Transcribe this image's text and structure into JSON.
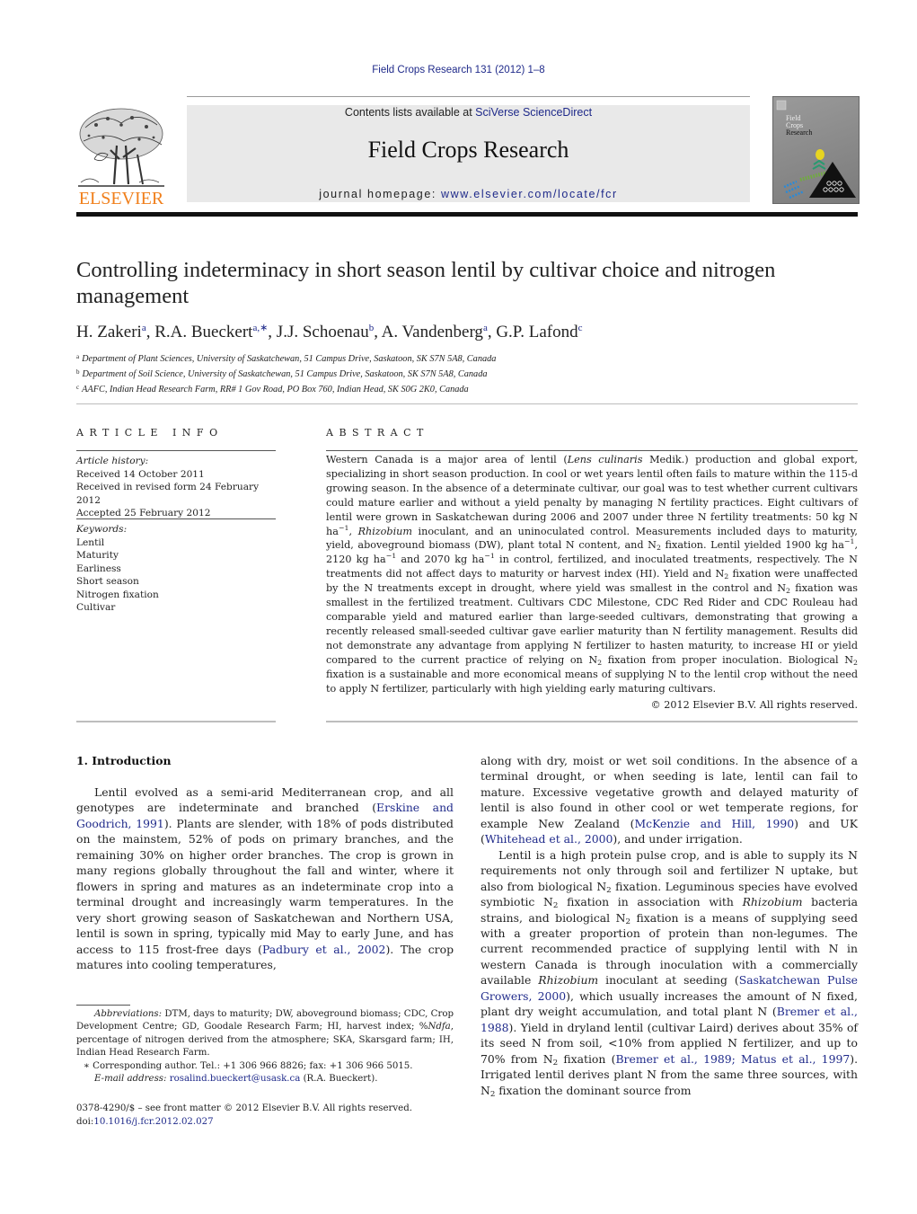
{
  "header": {
    "journal_ref": "Field Crops Research 131 (2012) 1–8",
    "contents_prefix": "Contents lists available at ",
    "contents_link": "SciVerse ScienceDirect",
    "journal_title": "Field Crops Research",
    "homepage_prefix": "journal homepage: ",
    "homepage_link": "www.elsevier.com/locate/fcr",
    "publisher_logo_text": "ELSEVIER",
    "cover_title": [
      "Field",
      "Crops",
      "Research"
    ],
    "colors": {
      "publisher_orange": "#f07f1b",
      "link_blue": "#1f2a8a",
      "banner_gray": "#e9e9e9"
    }
  },
  "article": {
    "title": "Controlling indeterminacy in short season lentil by cultivar choice and nitrogen management",
    "authors": [
      {
        "name": "H. Zakeri",
        "sup": "a"
      },
      {
        "name": "R.A. Bueckert",
        "sup": "a,∗"
      },
      {
        "name": "J.J. Schoenau",
        "sup": "b"
      },
      {
        "name": "A. Vandenberg",
        "sup": "a"
      },
      {
        "name": "G.P. Lafond",
        "sup": "c"
      }
    ],
    "affiliations": [
      {
        "key": "a",
        "text": "Department of Plant Sciences, University of Saskatchewan, 51 Campus Drive, Saskatoon, SK S7N 5A8, Canada"
      },
      {
        "key": "b",
        "text": "Department of Soil Science, University of Saskatchewan, 51 Campus Drive, Saskatoon, SK S7N 5A8, Canada"
      },
      {
        "key": "c",
        "text": "AAFC, Indian Head Research Farm, RR# 1 Gov Road, PO Box 760, Indian Head, SK S0G 2K0, Canada"
      }
    ]
  },
  "article_info": {
    "heading": "ARTICLE INFO",
    "history_label": "Article history:",
    "history": [
      "Received 14 October 2011",
      "Received in revised form 24 February 2012",
      "Accepted 25 February 2012"
    ],
    "keywords_label": "Keywords:",
    "keywords": [
      "Lentil",
      "Maturity",
      "Earliness",
      "Short season",
      "Nitrogen fixation",
      "Cultivar"
    ]
  },
  "abstract": {
    "heading": "ABSTRACT",
    "segments": [
      "Western Canada is a major area of lentil (",
      "Lens culinaris",
      " Medik.) production and global export, specializing in short season production. In cool or wet years lentil often fails to mature within the 115-d growing season. In the absence of a determinate cultivar, our goal was to test whether current cultivars could mature earlier and without a yield penalty by managing N fertility practices. Eight cultivars of lentil were grown in Saskatchewan during 2006 and 2007 under three N fertility treatments: 50 kg N ha",
      "−1",
      ", ",
      "Rhizobium",
      " inoculant, and an uninoculated control. Measurements included days to maturity, yield, aboveground biomass (DW), plant total N content, and N",
      "2",
      " fixation. Lentil yielded 1900 kg ha",
      "−1",
      ", 2120 kg ha",
      "−1",
      " and 2070 kg ha",
      "−1",
      " in control, fertilized, and inoculated treatments, respectively. The N treatments did not affect days to maturity or harvest index (HI). Yield and N",
      "2",
      " fixation were unaffected by the N treatments except in drought, where yield was smallest in the control and N",
      "2",
      " fixation was smallest in the fertilized treatment. Cultivars CDC Milestone, CDC Red Rider and CDC Rouleau had comparable yield and matured earlier than large-seeded cultivars, demonstrating that growing a recently released small-seeded cultivar gave earlier maturity than N fertility management. Results did not demonstrate any advantage from applying N fertilizer to hasten maturity, to increase HI or yield compared to the current practice of relying on N",
      "2",
      " fixation from proper inoculation. Biological N",
      "2",
      " fixation is a sustainable and more economical means of supplying N to the lentil crop without the need to apply N fertilizer, particularly with high yielding early maturing cultivars."
    ],
    "copyright": "© 2012 Elsevier B.V. All rights reserved."
  },
  "body": {
    "section_heading": "1.  Introduction",
    "left": {
      "p1": [
        "Lentil evolved as a semi-arid Mediterranean crop, and all genotypes are indeterminate and branched (",
        "Erskine and Goodrich, 1991",
        "). Plants are slender, with 18% of pods distributed on the mainstem, 52% of pods on primary branches, and the remaining 30% on higher order branches. The crop is grown in many regions globally throughout the fall and winter, where it flowers in spring and matures as an indeterminate crop into a terminal drought and increasingly warm temperatures. In the very short growing season of Saskatchewan and Northern USA, lentil is sown in spring, typically mid May to early June, and has access to 115 frost-free days (",
        "Padbury et al., 2002",
        "). The crop matures into cooling temperatures,"
      ]
    },
    "right": {
      "p1": [
        "along with dry, moist or wet soil conditions. In the absence of a terminal drought, or when seeding is late, lentil can fail to mature. Excessive vegetative growth and delayed maturity of lentil is also found in other cool or wet temperate regions, for example New Zealand (",
        "McKenzie and Hill, 1990",
        ") and UK (",
        "Whitehead et al., 2000",
        "), and under irrigation."
      ],
      "p2": [
        "Lentil is a high protein pulse crop, and is able to supply its N requirements not only through soil and fertilizer N uptake, but also from biological N",
        "2",
        " fixation. Leguminous species have evolved symbiotic N",
        "2",
        " fixation in association with ",
        "Rhizobium",
        " bacteria strains, and biological N",
        "2",
        " fixation is a means of supplying seed with a greater proportion of protein than non-legumes. The current recommended practice of supplying lentil with N in western Canada is through inoculation with a commercially available ",
        "Rhizobium",
        " inoculant at seeding (",
        "Saskatchewan Pulse Growers, 2000",
        "), which usually increases the amount of N fixed, plant dry weight accumulation, and total plant N (",
        "Bremer et al., 1988",
        "). Yield in dryland lentil (cultivar Laird) derives about 35% of its seed N from soil, <10% from applied N fertilizer, and up to 70% from N",
        "2",
        " fixation (",
        "Bremer et al., 1989; Matus et al., 1997",
        "). Irrigated lentil derives plant N from the same three sources, with N",
        "2",
        " fixation the dominant source from"
      ]
    }
  },
  "footnotes": {
    "abbrev_label": "Abbreviations:",
    "abbrev_text_1": " DTM, days to maturity; DW, aboveground biomass; CDC, Crop Development Centre; GD, Goodale Research Farm; HI, harvest index; %",
    "abbrev_ndfa": "Ndfa",
    "abbrev_text_2": ", percentage of nitrogen derived from the atmosphere; SKA, Skarsgard farm; IH, Indian Head Research Farm.",
    "corresponding": "∗  Corresponding author. Tel.: +1 306 966 8826; fax: +1 306 966 5015.",
    "email_label": "E-mail address:",
    "email": "rosalind.bueckert@usask.ca",
    "email_suffix": " (R.A. Bueckert).",
    "front_matter": "0378-4290/$ – see front matter © 2012 Elsevier B.V. All rights reserved.",
    "doi_prefix": "doi:",
    "doi": "10.1016/j.fcr.2012.02.027"
  }
}
